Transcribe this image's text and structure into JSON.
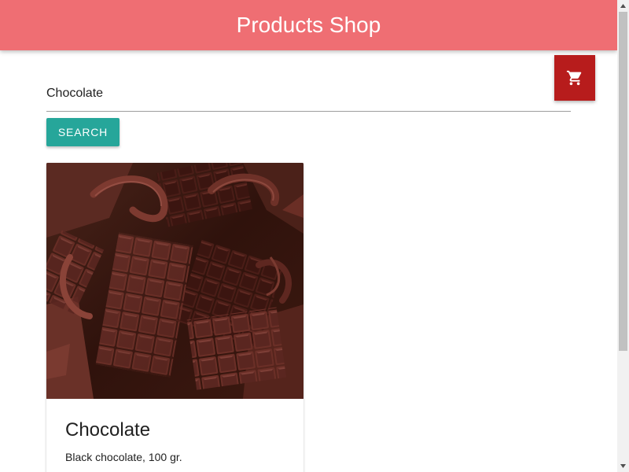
{
  "app": {
    "title": "Products Shop"
  },
  "cart": {
    "icon": "shopping-cart-icon"
  },
  "search": {
    "value": "Chocolate",
    "button_label": "Search"
  },
  "products": [
    {
      "name": "Chocolate",
      "description": "Black chocolate, 100 gr."
    }
  ],
  "colors": {
    "header": "#ef6e73",
    "cart_button": "#b71c1c",
    "search_button": "#26a69a"
  }
}
